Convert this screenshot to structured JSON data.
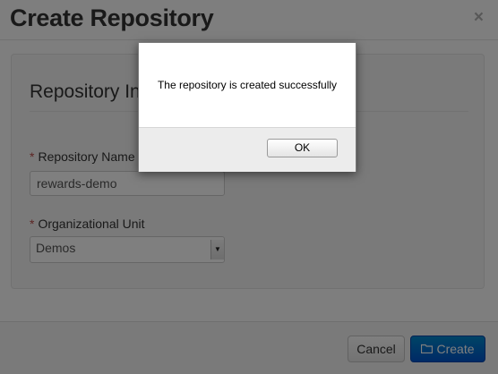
{
  "modal": {
    "title": "Create Repository",
    "close_label": "×",
    "section_title": "Repository Information",
    "repository_name": {
      "required_mark": "*",
      "label": "Repository Name",
      "value": "rewards-demo"
    },
    "organizational_unit": {
      "required_mark": "*",
      "label": "Organizational Unit",
      "selected": "Demos"
    },
    "footer": {
      "cancel_label": "Cancel",
      "create_label": "Create"
    }
  },
  "alert": {
    "message": "The repository is created successfully",
    "ok_label": "OK"
  },
  "icons": {
    "create_button": "folder-icon",
    "select": "chevron-down-icon"
  },
  "colors": {
    "primary": "#0066cc",
    "required": "#b94a48"
  }
}
